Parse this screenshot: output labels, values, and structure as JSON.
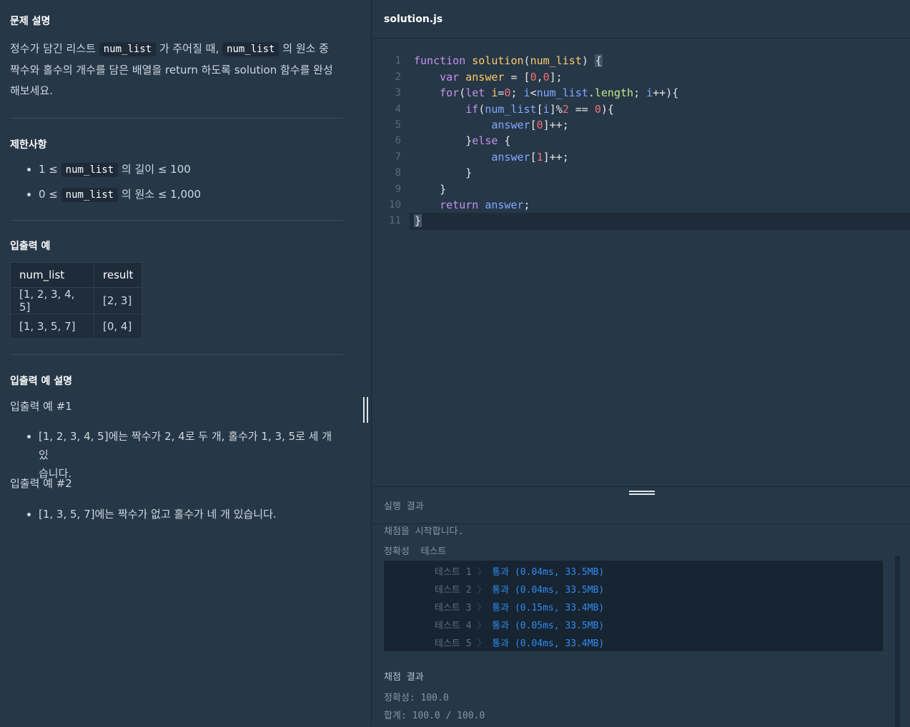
{
  "problem": {
    "title": "문제 설명",
    "desc_1": "정수가 담긴 리스트",
    "code_1": "num_list",
    "desc_2": "가 주어질 때,",
    "code_2": "num_list",
    "desc_3": "의 원소 중",
    "desc_4": "짝수와 홀수의 개수를 담은 배열을 return 하도록 solution 함수를 완성",
    "desc_5": "해보세요."
  },
  "constraints": {
    "title": "제한사항",
    "items": [
      {
        "pre": "1 ≤",
        "code": "num_list",
        "post": "의 길이 ≤ 100"
      },
      {
        "pre": "0 ≤",
        "code": "num_list",
        "post": "의 원소 ≤ 1,000"
      }
    ]
  },
  "io_example": {
    "title": "입출력 예",
    "headers": [
      "num_list",
      "result"
    ],
    "rows": [
      [
        "[1, 2, 3, 4, 5]",
        "[2, 3]"
      ],
      [
        "[1, 3, 5, 7]",
        "[0, 4]"
      ]
    ]
  },
  "io_explanation": {
    "title": "입출력 예 설명",
    "ex1_title": "입출력 예 #1",
    "ex1_line1": "[1, 2, 3, 4, 5]에는 짝수가 2, 4로 두 개, 홀수가 1, 3, 5로 세 개 있",
    "ex1_line2": "습니다.",
    "ex2_title": "입출력 예 #2",
    "ex2_line1": "[1, 3, 5, 7]에는 짝수가 없고 홀수가 네 개 있습니다."
  },
  "editor": {
    "filename": "solution.js",
    "line_numbers": [
      "1",
      "2",
      "3",
      "4",
      "5",
      "6",
      "7",
      "8",
      "9",
      "10",
      "11"
    ],
    "code": {
      "l1_kw": "function",
      "l1_fn": "solution",
      "l1_open": "(",
      "l1_param": "num_list",
      "l1_close": ")",
      "l1_brace": "{",
      "l2_kw": "var",
      "l2_var": "answer",
      "l2_eq": " = [",
      "l2_n1": "0",
      "l2_comma": ",",
      "l2_n2": "0",
      "l2_end": "];",
      "l3_kw": "for",
      "l3_open": "(",
      "l3_let": "let",
      "l3_i1": "i",
      "l3_assign": "=",
      "l3_zero": "0",
      "l3_semi1": "; ",
      "l3_i2": "i",
      "l3_lt": "<",
      "l3_list": "num_list",
      "l3_dot": ".",
      "l3_len": "length",
      "l3_semi2": "; ",
      "l3_i3": "i",
      "l3_inc": "++){",
      "l4_kw": "if",
      "l4_open": "(",
      "l4_list": "num_list",
      "l4_br1": "[",
      "l4_i": "i",
      "l4_br2": "]",
      "l4_mod": "%",
      "l4_two": "2",
      "l4_eq": " == ",
      "l4_zero": "0",
      "l4_close": "){",
      "l5_var": "answer",
      "l5_br1": "[",
      "l5_idx": "0",
      "l5_end": "]++;",
      "l6_brace": "}",
      "l6_else": "else",
      "l6_open": " {",
      "l7_var": "answer",
      "l7_br1": "[",
      "l7_idx": "1",
      "l7_end": "]++;",
      "l8": "}",
      "l9": "}",
      "l10_kw": "return",
      "l10_var": "answer",
      "l10_end": ";",
      "l11": "}"
    }
  },
  "result": {
    "title": "실행 결과",
    "start_msg": "채점을 시작합니다.",
    "accuracy_label": "정확성  테스트",
    "tests": [
      {
        "name": "테스트 1",
        "arrow": "〉",
        "result": "통과 (0.04ms, 33.5MB)"
      },
      {
        "name": "테스트 2",
        "arrow": "〉",
        "result": "통과 (0.04ms, 33.5MB)"
      },
      {
        "name": "테스트 3",
        "arrow": "〉",
        "result": "통과 (0.15ms, 33.4MB)"
      },
      {
        "name": "테스트 4",
        "arrow": "〉",
        "result": "통과 (0.05ms, 33.5MB)"
      },
      {
        "name": "테스트 5",
        "arrow": "〉",
        "result": "통과 (0.04ms, 33.4MB)"
      }
    ],
    "grading_title": "채점 결과",
    "accuracy_score": "정확성: 100.0",
    "total_score": "합계: 100.0 / 100.0"
  },
  "colors": {
    "background": "#263747",
    "keyword": "#c792ea",
    "function": "#ffcb6b",
    "variable": "#82aaff",
    "number": "#f07178",
    "property": "#c3e88d",
    "pass": "#2f8cf0"
  }
}
